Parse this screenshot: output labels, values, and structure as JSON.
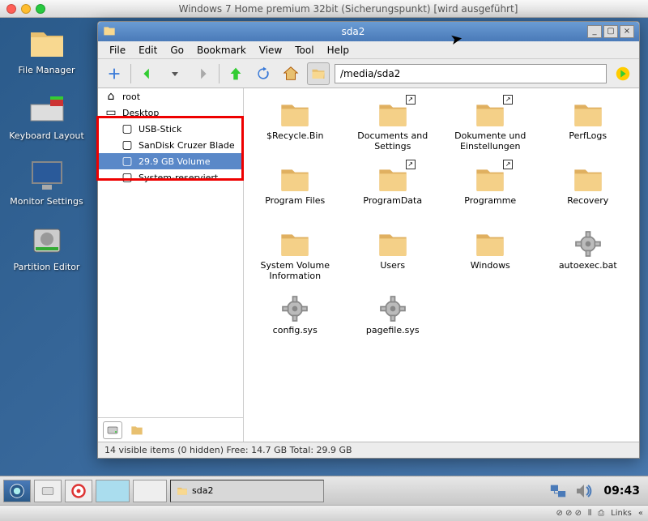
{
  "mac_title": "Windows 7 Home premium 32bit (Sicherungspunkt) [wird ausgeführt]",
  "desktop": [
    {
      "label": "File Manager",
      "icon": "folder"
    },
    {
      "label": "Keyboard Layout",
      "icon": "keyboard"
    },
    {
      "label": "Monitor Settings",
      "icon": "monitor"
    },
    {
      "label": "Partition Editor",
      "icon": "disk"
    }
  ],
  "window": {
    "title": "sda2",
    "path": "/media/sda2",
    "menu": [
      "File",
      "Edit",
      "Go",
      "Bookmark",
      "View",
      "Tool",
      "Help"
    ],
    "sidebar": [
      {
        "label": "root",
        "icon": "home",
        "indent": false,
        "sel": false
      },
      {
        "label": "Desktop",
        "icon": "desktop",
        "indent": false,
        "sel": false
      },
      {
        "label": "USB-Stick",
        "icon": "drive",
        "indent": true,
        "sel": false
      },
      {
        "label": "SanDisk Cruzer Blade",
        "icon": "drive",
        "indent": true,
        "sel": false
      },
      {
        "label": "29.9 GB Volume",
        "icon": "drive",
        "indent": true,
        "sel": true
      },
      {
        "label": "System-reserviert",
        "icon": "drive",
        "indent": true,
        "sel": false
      }
    ],
    "items": [
      {
        "label": "$Recycle.Bin",
        "type": "folder",
        "shortcut": false
      },
      {
        "label": "Documents and Settings",
        "type": "folder",
        "shortcut": true
      },
      {
        "label": "Dokumente und Einstellungen",
        "type": "folder",
        "shortcut": true
      },
      {
        "label": "PerfLogs",
        "type": "folder",
        "shortcut": false
      },
      {
        "label": "Program Files",
        "type": "folder",
        "shortcut": false
      },
      {
        "label": "ProgramData",
        "type": "folder",
        "shortcut": true
      },
      {
        "label": "Programme",
        "type": "folder",
        "shortcut": true
      },
      {
        "label": "Recovery",
        "type": "folder",
        "shortcut": false
      },
      {
        "label": "System Volume Information",
        "type": "folder",
        "shortcut": false
      },
      {
        "label": "Users",
        "type": "folder",
        "shortcut": false
      },
      {
        "label": "Windows",
        "type": "folder",
        "shortcut": false
      },
      {
        "label": "autoexec.bat",
        "type": "gear",
        "shortcut": false
      },
      {
        "label": "config.sys",
        "type": "gear",
        "shortcut": false
      },
      {
        "label": "pagefile.sys",
        "type": "gear",
        "shortcut": false
      }
    ],
    "status": "14 visible items (0 hidden) Free: 14.7 GB Total: 29.9 GB"
  },
  "taskbar": {
    "active_label": "sda2"
  },
  "clock": "09:43",
  "tray_links": "Links"
}
